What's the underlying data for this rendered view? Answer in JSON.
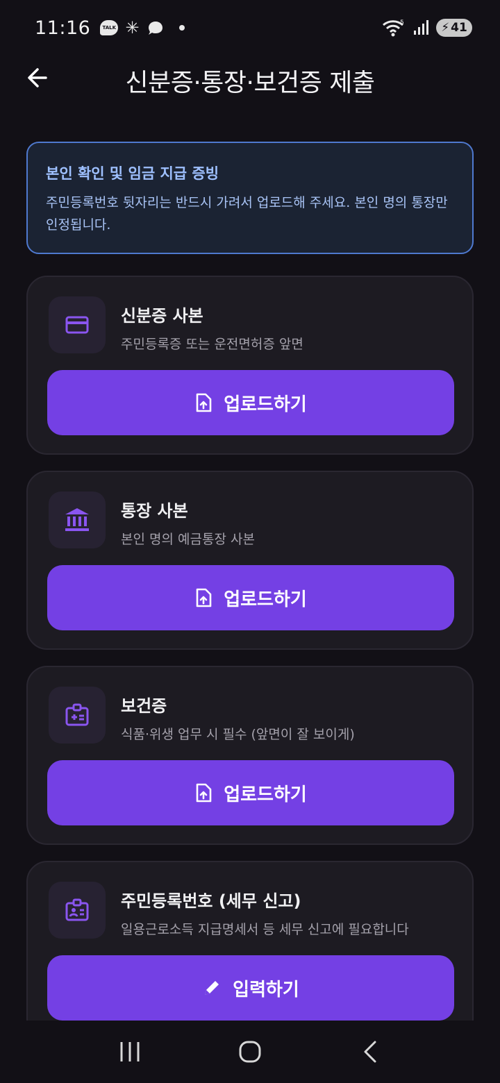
{
  "status_bar": {
    "time": "11:16",
    "talk_badge": "TALK",
    "battery_level": "41",
    "wifi_label": "5"
  },
  "header": {
    "title": "신분증·통장·보건증 제출"
  },
  "notice": {
    "title": "본인 확인 및 임금 지급 증빙",
    "body": "주민등록번호 뒷자리는 반드시 가려서 업로드해 주세요. 본인 명의 통장만 인정됩니다."
  },
  "cards": [
    {
      "title": "신분증 사본",
      "description": "주민등록증 또는 운전면허증 앞면",
      "button_label": "업로드하기",
      "icon": "id-card-icon"
    },
    {
      "title": "통장 사본",
      "description": "본인 명의 예금통장 사본",
      "button_label": "업로드하기",
      "icon": "bank-icon"
    },
    {
      "title": "보건증",
      "description": "식품·위생 업무 시 필수 (앞면이 잘 보이게)",
      "button_label": "업로드하기",
      "icon": "health-card-icon"
    },
    {
      "title": "주민등록번호 (세무 신고)",
      "description": "일용근로소득 지급명세서 등 세무 신고에 필요합니다",
      "button_label": "입력하기",
      "icon": "badge-icon"
    }
  ],
  "colors": {
    "background": "#121016",
    "accent": "#7440e4",
    "notice_border": "#4f79cf",
    "notice_text": "#a9c4f6",
    "icon_purple": "#8a55f0"
  }
}
